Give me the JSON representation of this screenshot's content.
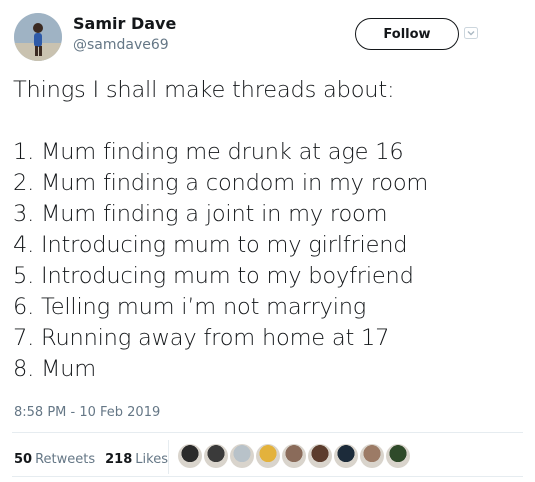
{
  "user": {
    "display_name": "Samir Dave",
    "handle": "@samdave69",
    "avatar_icon": "profile-photo"
  },
  "follow": {
    "label": "Follow"
  },
  "tweet": {
    "heading": "Things I shall make threads about:",
    "items": [
      "1. Mum finding me drunk at age 16",
      "2. Mum finding a condom in my room",
      "3. Mum finding a joint in my room",
      "4. Introducing mum to my girlfriend",
      "5. Introducing mum to my boyfriend",
      "6. Telling mum i’m not marrying",
      "7. Running away from home at 17",
      "8. Mum"
    ],
    "timestamp": "8:58 PM - 10 Feb 2019"
  },
  "stats": {
    "retweets_count": "50",
    "retweets_label": "Retweets",
    "likes_count": "218",
    "likes_label": "Likes"
  },
  "likers": [
    {
      "icon": "liker-avatar",
      "color": "#2b2b2b"
    },
    {
      "icon": "liker-avatar",
      "color": "#3a3a3a"
    },
    {
      "icon": "liker-avatar",
      "color": "#b8c2c9"
    },
    {
      "icon": "liker-avatar",
      "color": "#e3b23c"
    },
    {
      "icon": "liker-avatar",
      "color": "#8a6b5a"
    },
    {
      "icon": "liker-avatar",
      "color": "#5c3d2e"
    },
    {
      "icon": "liker-avatar",
      "color": "#1c2b3a"
    },
    {
      "icon": "liker-avatar",
      "color": "#9c7b66"
    },
    {
      "icon": "liker-avatar",
      "color": "#2f4a2a"
    }
  ],
  "colors": {
    "text": "#14171a",
    "muted": "#657786",
    "divider": "#e6ecf0"
  }
}
